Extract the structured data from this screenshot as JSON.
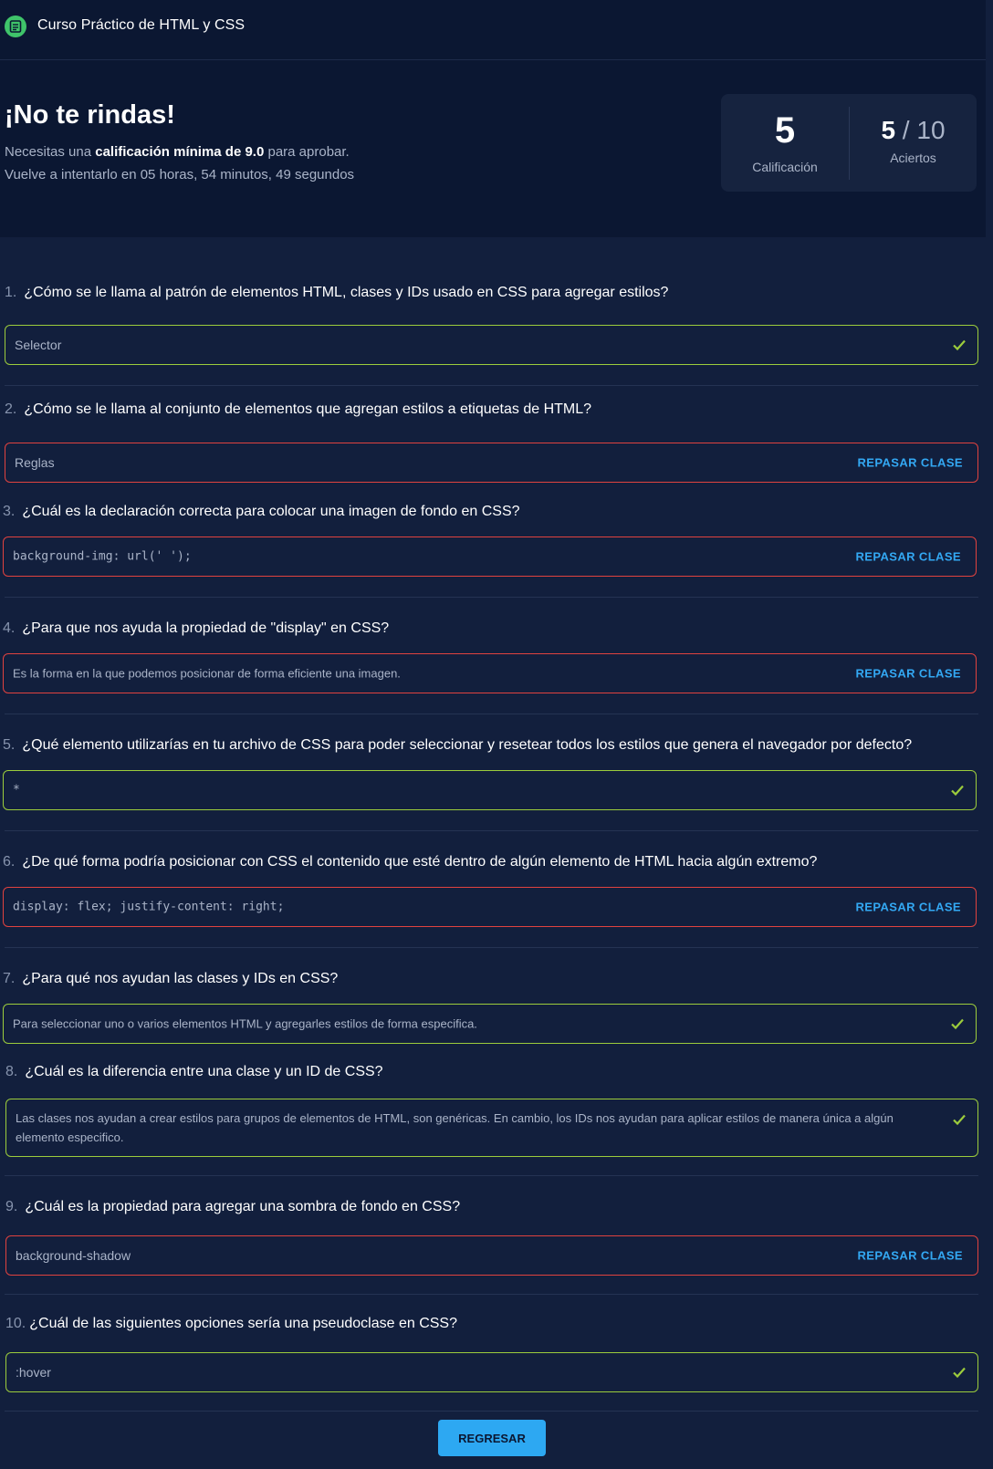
{
  "header": {
    "course_title": "Curso Práctico de HTML y CSS",
    "icon": "document-icon"
  },
  "result": {
    "heading": "¡No te rindas!",
    "requirement_prefix": "Necesitas una ",
    "requirement_bold": "calificación mínima de 9.0",
    "requirement_suffix": " para aprobar.",
    "retry_text": "Vuelve a intentarlo en 05 horas, 54 minutos, 49 segundos",
    "grade": "5",
    "grade_label": "Calificación",
    "hits_correct": "5",
    "hits_separator": " / ",
    "hits_total": "10",
    "hits_label": "Aciertos"
  },
  "review_label": "REPASAR CLASE",
  "questions": [
    {
      "number": "1.",
      "text": "¿Cómo se le llama al patrón de elementos HTML, clases y IDs usado en CSS para agregar estilos?",
      "answer": "Selector",
      "status": "correct"
    },
    {
      "number": "2.",
      "text": "¿Cómo se le llama al conjunto de elementos que agregan estilos a etiquetas de HTML?",
      "answer": "Reglas",
      "status": "wrong"
    },
    {
      "number": "3.",
      "text": "¿Cuál es la declaración correcta para colocar una imagen de fondo en CSS?",
      "answer": "background-img: url(' ');",
      "status": "wrong"
    },
    {
      "number": "4.",
      "text": "¿Para que nos ayuda la propiedad de \"display\" en CSS?",
      "answer": "Es la forma en la que podemos posicionar de forma eficiente una imagen.",
      "status": "wrong"
    },
    {
      "number": "5.",
      "text": "¿Qué elemento utilizarías en tu archivo de CSS para poder seleccionar y resetear todos los estilos que genera el navegador por defecto?",
      "answer": "*",
      "status": "correct"
    },
    {
      "number": "6.",
      "text": "¿De qué forma podría posicionar con CSS el contenido que esté dentro de algún elemento de HTML hacia algún extremo?",
      "answer": "display: flex; justify-content: right;",
      "status": "wrong"
    },
    {
      "number": "7.",
      "text": "¿Para qué nos ayudan las clases y IDs en CSS?",
      "answer": "Para seleccionar uno o varios elementos HTML y agregarles estilos de forma especifica.",
      "status": "correct"
    },
    {
      "number": "8.",
      "text": "¿Cuál es la diferencia entre una clase y un ID de CSS?",
      "answer": "Las clases nos ayudan a crear estilos para grupos de elementos de HTML, son genéricas. En cambio, los IDs nos ayudan para aplicar estilos de manera única a algún elemento especifico.",
      "status": "correct"
    },
    {
      "number": "9.",
      "text": "¿Cuál es la propiedad para agregar una sombra de fondo en CSS?",
      "answer": "background-shadow",
      "status": "wrong"
    },
    {
      "number": "10.",
      "text": "¿Cuál de las siguientes opciones sería una pseudoclase en CSS?",
      "answer": ":hover",
      "status": "correct"
    }
  ],
  "back_button": "REGRESAR",
  "colors": {
    "correct": "#9ccc3c",
    "wrong": "#e0423f",
    "accent": "#2da8f2",
    "background": "#121f3d",
    "header_background": "#0b1732"
  }
}
